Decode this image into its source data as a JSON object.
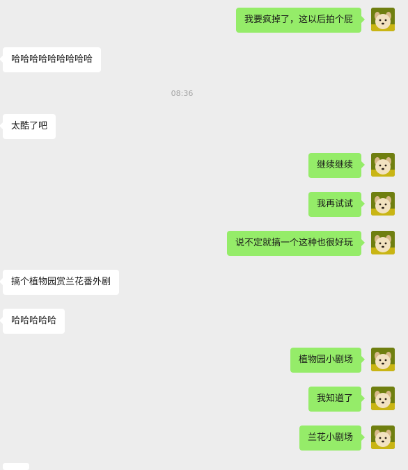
{
  "chat": {
    "messages": [
      {
        "side": "out",
        "text": "我要疯掉了，这以后拍个屁"
      },
      {
        "side": "in",
        "text": "哈哈哈哈哈哈哈哈哈"
      },
      {
        "side": "time",
        "text": "08:36"
      },
      {
        "side": "in",
        "text": "太酷了吧"
      },
      {
        "side": "out",
        "text": "继续继续"
      },
      {
        "side": "out",
        "text": "我再试试"
      },
      {
        "side": "out",
        "text": "说不定就搞一个这种也很好玩"
      },
      {
        "side": "in",
        "text": "搞个植物园赏兰花番外剧"
      },
      {
        "side": "in",
        "text": "哈哈哈哈哈"
      },
      {
        "side": "out",
        "text": "植物园小剧场"
      },
      {
        "side": "out",
        "text": "我知道了"
      },
      {
        "side": "out",
        "text": "兰花小剧场"
      }
    ]
  },
  "avatar_icon": "avatar-dog-photo-icon",
  "colors": {
    "background": "#ededed",
    "outgoing_bubble": "#95ec69",
    "incoming_bubble": "#ffffff",
    "timestamp_text": "#a3a3a3"
  }
}
